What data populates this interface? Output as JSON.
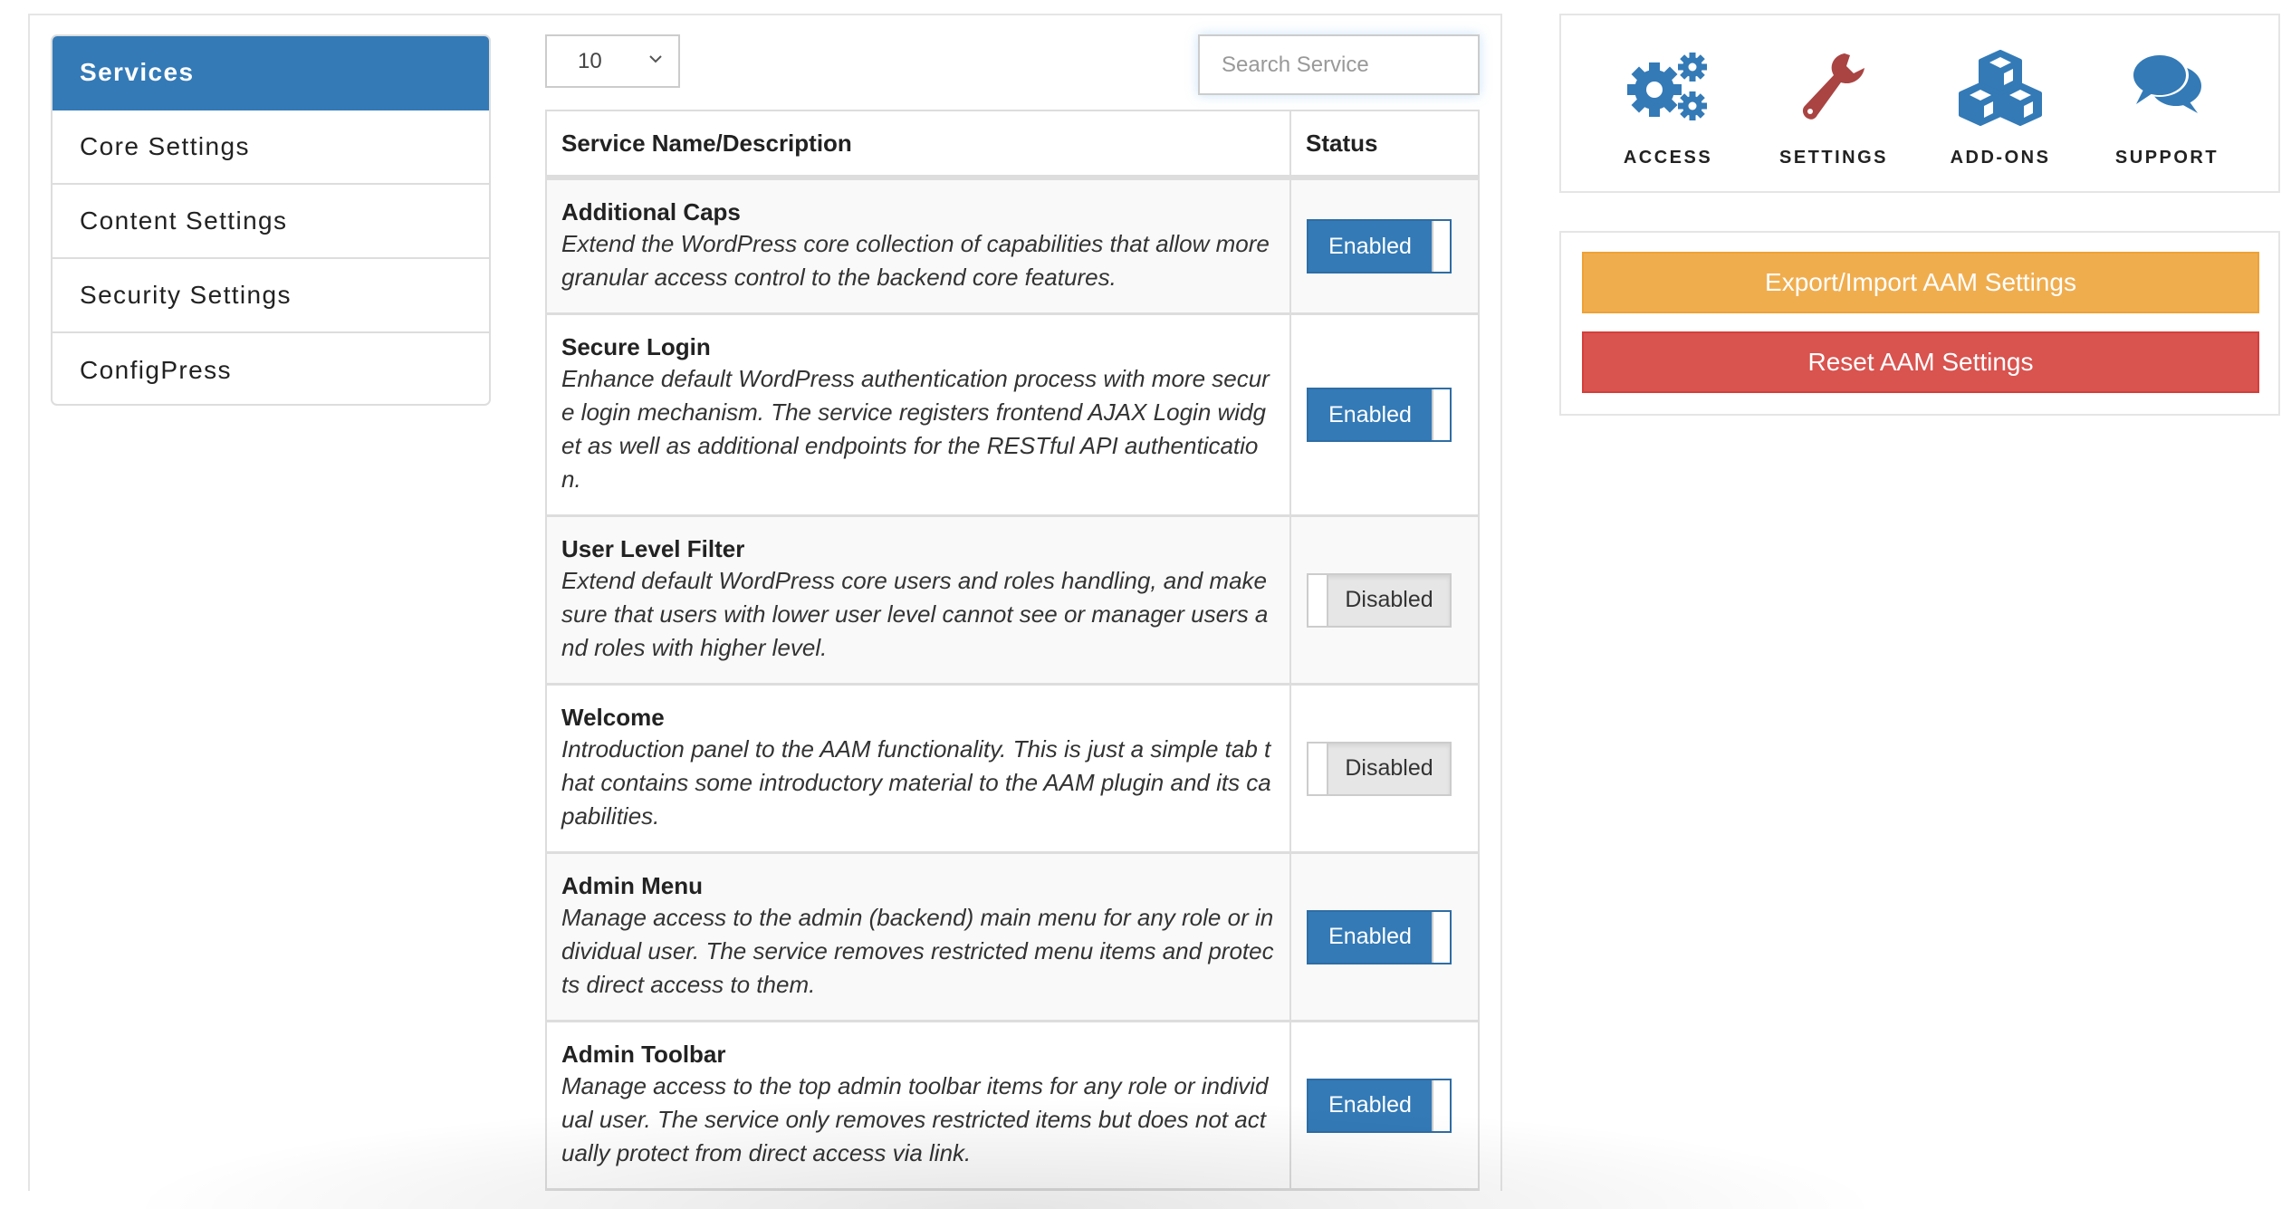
{
  "sidebar": {
    "items": [
      {
        "label": "Services",
        "active": true
      },
      {
        "label": "Core Settings",
        "active": false
      },
      {
        "label": "Content Settings",
        "active": false
      },
      {
        "label": "Security Settings",
        "active": false
      },
      {
        "label": "ConfigPress",
        "active": false
      }
    ]
  },
  "controls": {
    "page_size": "10",
    "search_placeholder": "Search Service",
    "search_value": ""
  },
  "table": {
    "columns": [
      "Service Name/Description",
      "Status"
    ],
    "rows": [
      {
        "title": "Additional Caps",
        "description": "Extend the WordPress core collection of capabilities that allow more granular access control to the backend core features.",
        "status": "Enabled",
        "enabled": true
      },
      {
        "title": "Secure Login",
        "description": "Enhance default WordPress authentication process with more secure login mechanism. The service registers frontend AJAX Login widget as well as additional endpoints for the RESTful API authentication.",
        "status": "Enabled",
        "enabled": true
      },
      {
        "title": "User Level Filter",
        "description": "Extend default WordPress core users and roles handling, and make sure that users with lower user level cannot see or manager users and roles with higher level.",
        "status": "Disabled",
        "enabled": false
      },
      {
        "title": "Welcome",
        "description": "Introduction panel to the AAM functionality. This is just a simple tab that contains some introductory material to the AAM plugin and its capabilities.",
        "status": "Disabled",
        "enabled": false
      },
      {
        "title": "Admin Menu",
        "description": "Manage access to the admin (backend) main menu for any role or individual user. The service removes restricted menu items and protects direct access to them.",
        "status": "Enabled",
        "enabled": true
      },
      {
        "title": "Admin Toolbar",
        "description": "Manage access to the top admin toolbar items for any role or individual user. The service only removes restricted items but does not actually protect from direct access via link.",
        "status": "Enabled",
        "enabled": true
      }
    ]
  },
  "top_nav": {
    "items": [
      {
        "label": "ACCESS",
        "icon": "gears-icon",
        "color": "#337ab7"
      },
      {
        "label": "SETTINGS",
        "icon": "wrench-icon",
        "color": "#a94442"
      },
      {
        "label": "ADD-ONS",
        "icon": "cubes-icon",
        "color": "#337ab7"
      },
      {
        "label": "SUPPORT",
        "icon": "chat-bubbles-icon",
        "color": "#337ab7"
      }
    ]
  },
  "actions": {
    "export_label": "Export/Import AAM Settings",
    "reset_label": "Reset AAM Settings"
  },
  "colors": {
    "primary": "#337ab7",
    "warning": "#f0ad4e",
    "danger": "#d9534f",
    "settings_icon": "#a94442"
  }
}
